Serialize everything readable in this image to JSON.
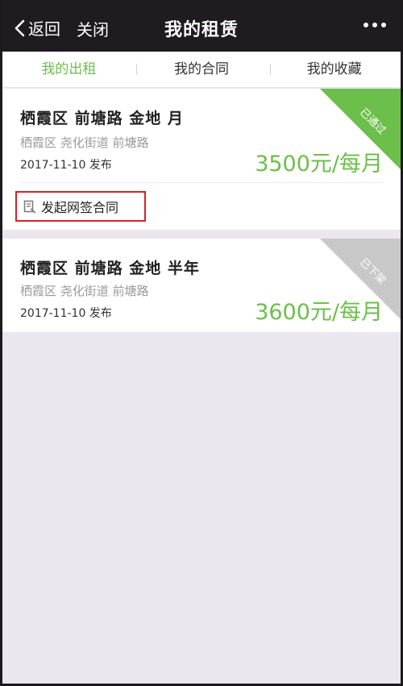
{
  "navbar": {
    "back_label": "返回",
    "close_label": "关闭",
    "title": "我的租赁"
  },
  "tabs": [
    {
      "label": "我的出租",
      "active": true
    },
    {
      "label": "我的合同",
      "active": false
    },
    {
      "label": "我的收藏",
      "active": false
    }
  ],
  "listings": [
    {
      "title": "栖霞区 前塘路 金地 月",
      "address": "栖霞区 尧化街道 前塘路",
      "date": "2017-11-10 发布",
      "price": "3500元/每月",
      "status": "已通过",
      "status_color": "#6cbf4a",
      "action_label": "发起网签合同",
      "action_icon": "document-icon"
    },
    {
      "title": "栖霞区 前塘路 金地 半年",
      "address": "栖霞区 尧化街道 前塘路",
      "date": "2017-11-10 发布",
      "price": "3600元/每月",
      "status": "已下架",
      "status_color": "#c8c8c8"
    }
  ],
  "colors": {
    "accent": "#6cbf4a",
    "navbar_bg": "#1f1b20",
    "highlight_border": "#d8202a",
    "page_bg": "#ece6ef"
  }
}
